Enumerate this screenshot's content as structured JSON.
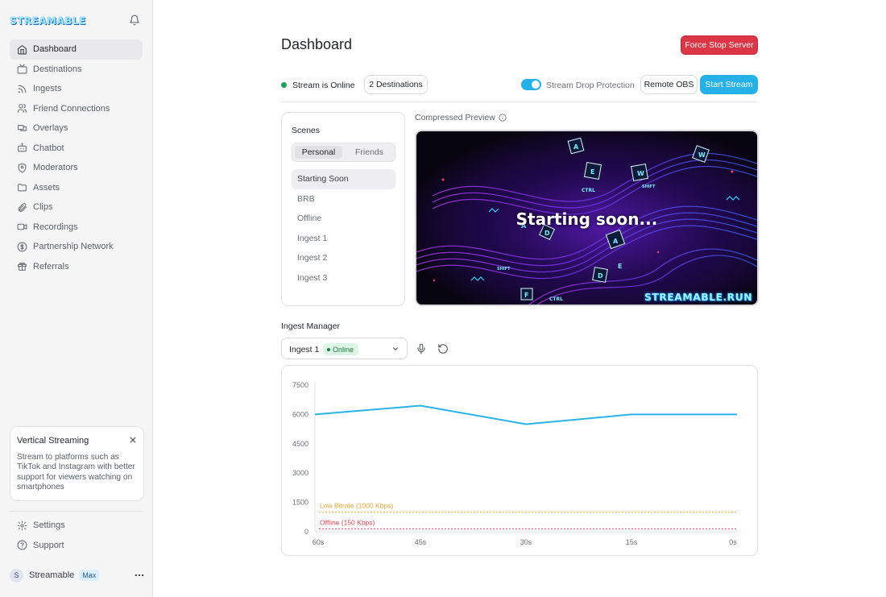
{
  "app": {
    "logo": "STREAMABLE"
  },
  "sidebar": {
    "items": [
      {
        "label": "Dashboard",
        "icon": "home-icon",
        "active": true
      },
      {
        "label": "Destinations",
        "icon": "tv-icon"
      },
      {
        "label": "Ingests",
        "icon": "rss-icon"
      },
      {
        "label": "Friend Connections",
        "icon": "users-icon"
      },
      {
        "label": "Overlays",
        "icon": "layers-icon"
      },
      {
        "label": "Chatbot",
        "icon": "bot-icon"
      },
      {
        "label": "Moderators",
        "icon": "shield-icon"
      },
      {
        "label": "Assets",
        "icon": "folder-icon"
      },
      {
        "label": "Clips",
        "icon": "paperclip-icon"
      },
      {
        "label": "Recordings",
        "icon": "video-icon"
      },
      {
        "label": "Partnership Network",
        "icon": "dollar-icon"
      },
      {
        "label": "Referrals",
        "icon": "gift-icon"
      }
    ],
    "promo": {
      "title": "Vertical Streaming",
      "body": "Stream to platforms such as TikTok and Instagram with better support for viewers watching on smartphones"
    },
    "bottom": [
      {
        "label": "Settings",
        "icon": "gear-icon"
      },
      {
        "label": "Support",
        "icon": "help-icon"
      }
    ],
    "user": {
      "initial": "S",
      "name": "Streamable",
      "plan": "Max"
    }
  },
  "header": {
    "title": "Dashboard",
    "force_stop_label": "Force Stop Server"
  },
  "status": {
    "online_text": "Stream is Online",
    "destinations_label": "2 Destinations",
    "drop_protection_label": "Stream Drop Protection",
    "drop_protection_on": true,
    "remote_obs_label": "Remote OBS",
    "start_stream_label": "Start Stream"
  },
  "scenes": {
    "title": "Scenes",
    "tabs": [
      "Personal",
      "Friends"
    ],
    "items": [
      "Starting Soon",
      "BRB",
      "Offline",
      "Ingest 1",
      "Ingest 2",
      "Ingest 3"
    ]
  },
  "preview": {
    "label": "Compressed Preview",
    "overlay_text": "Starting soon...",
    "brand_text": "STREAMABLE.RUN"
  },
  "ingest": {
    "title": "Ingest Manager",
    "selected": "Ingest 1",
    "status_badge": "Online"
  },
  "chart_data": {
    "type": "line",
    "x_ticks": [
      "60s",
      "45s",
      "30s",
      "15s",
      "0s"
    ],
    "y_ticks": [
      0,
      1500,
      3000,
      4500,
      6000,
      7500
    ],
    "ylim": [
      0,
      7500
    ],
    "x": [
      60,
      45,
      30,
      15,
      0
    ],
    "series": [
      {
        "values": [
          6000,
          6450,
          5500,
          6000,
          6000
        ],
        "color": "#29b3ea"
      }
    ],
    "thresholds": [
      {
        "label": "Low Bitrate (1000 Kbps)",
        "value": 1000,
        "color": "#f0a53a"
      },
      {
        "label": "Offline (150 Kbps)",
        "value": 150,
        "color": "#e0434f"
      }
    ]
  }
}
